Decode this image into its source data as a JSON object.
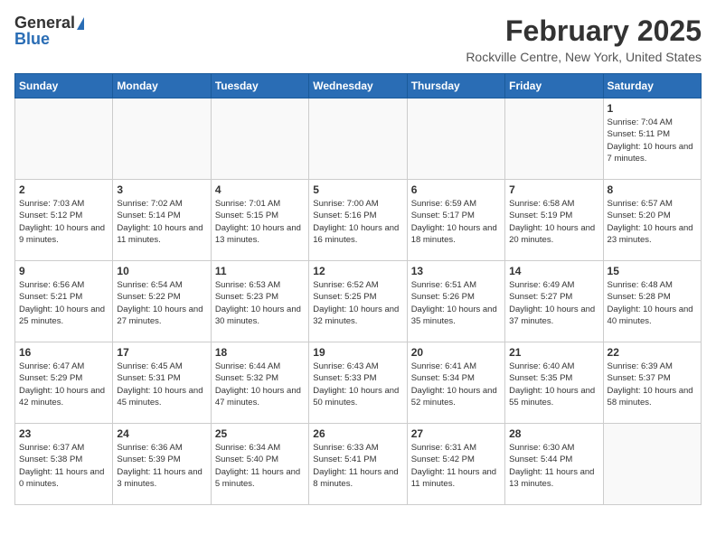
{
  "header": {
    "logo_general": "General",
    "logo_blue": "Blue",
    "month_year": "February 2025",
    "location": "Rockville Centre, New York, United States"
  },
  "weekdays": [
    "Sunday",
    "Monday",
    "Tuesday",
    "Wednesday",
    "Thursday",
    "Friday",
    "Saturday"
  ],
  "weeks": [
    [
      {
        "day": "",
        "info": ""
      },
      {
        "day": "",
        "info": ""
      },
      {
        "day": "",
        "info": ""
      },
      {
        "day": "",
        "info": ""
      },
      {
        "day": "",
        "info": ""
      },
      {
        "day": "",
        "info": ""
      },
      {
        "day": "1",
        "info": "Sunrise: 7:04 AM\nSunset: 5:11 PM\nDaylight: 10 hours and 7 minutes."
      }
    ],
    [
      {
        "day": "2",
        "info": "Sunrise: 7:03 AM\nSunset: 5:12 PM\nDaylight: 10 hours and 9 minutes."
      },
      {
        "day": "3",
        "info": "Sunrise: 7:02 AM\nSunset: 5:14 PM\nDaylight: 10 hours and 11 minutes."
      },
      {
        "day": "4",
        "info": "Sunrise: 7:01 AM\nSunset: 5:15 PM\nDaylight: 10 hours and 13 minutes."
      },
      {
        "day": "5",
        "info": "Sunrise: 7:00 AM\nSunset: 5:16 PM\nDaylight: 10 hours and 16 minutes."
      },
      {
        "day": "6",
        "info": "Sunrise: 6:59 AM\nSunset: 5:17 PM\nDaylight: 10 hours and 18 minutes."
      },
      {
        "day": "7",
        "info": "Sunrise: 6:58 AM\nSunset: 5:19 PM\nDaylight: 10 hours and 20 minutes."
      },
      {
        "day": "8",
        "info": "Sunrise: 6:57 AM\nSunset: 5:20 PM\nDaylight: 10 hours and 23 minutes."
      }
    ],
    [
      {
        "day": "9",
        "info": "Sunrise: 6:56 AM\nSunset: 5:21 PM\nDaylight: 10 hours and 25 minutes."
      },
      {
        "day": "10",
        "info": "Sunrise: 6:54 AM\nSunset: 5:22 PM\nDaylight: 10 hours and 27 minutes."
      },
      {
        "day": "11",
        "info": "Sunrise: 6:53 AM\nSunset: 5:23 PM\nDaylight: 10 hours and 30 minutes."
      },
      {
        "day": "12",
        "info": "Sunrise: 6:52 AM\nSunset: 5:25 PM\nDaylight: 10 hours and 32 minutes."
      },
      {
        "day": "13",
        "info": "Sunrise: 6:51 AM\nSunset: 5:26 PM\nDaylight: 10 hours and 35 minutes."
      },
      {
        "day": "14",
        "info": "Sunrise: 6:49 AM\nSunset: 5:27 PM\nDaylight: 10 hours and 37 minutes."
      },
      {
        "day": "15",
        "info": "Sunrise: 6:48 AM\nSunset: 5:28 PM\nDaylight: 10 hours and 40 minutes."
      }
    ],
    [
      {
        "day": "16",
        "info": "Sunrise: 6:47 AM\nSunset: 5:29 PM\nDaylight: 10 hours and 42 minutes."
      },
      {
        "day": "17",
        "info": "Sunrise: 6:45 AM\nSunset: 5:31 PM\nDaylight: 10 hours and 45 minutes."
      },
      {
        "day": "18",
        "info": "Sunrise: 6:44 AM\nSunset: 5:32 PM\nDaylight: 10 hours and 47 minutes."
      },
      {
        "day": "19",
        "info": "Sunrise: 6:43 AM\nSunset: 5:33 PM\nDaylight: 10 hours and 50 minutes."
      },
      {
        "day": "20",
        "info": "Sunrise: 6:41 AM\nSunset: 5:34 PM\nDaylight: 10 hours and 52 minutes."
      },
      {
        "day": "21",
        "info": "Sunrise: 6:40 AM\nSunset: 5:35 PM\nDaylight: 10 hours and 55 minutes."
      },
      {
        "day": "22",
        "info": "Sunrise: 6:39 AM\nSunset: 5:37 PM\nDaylight: 10 hours and 58 minutes."
      }
    ],
    [
      {
        "day": "23",
        "info": "Sunrise: 6:37 AM\nSunset: 5:38 PM\nDaylight: 11 hours and 0 minutes."
      },
      {
        "day": "24",
        "info": "Sunrise: 6:36 AM\nSunset: 5:39 PM\nDaylight: 11 hours and 3 minutes."
      },
      {
        "day": "25",
        "info": "Sunrise: 6:34 AM\nSunset: 5:40 PM\nDaylight: 11 hours and 5 minutes."
      },
      {
        "day": "26",
        "info": "Sunrise: 6:33 AM\nSunset: 5:41 PM\nDaylight: 11 hours and 8 minutes."
      },
      {
        "day": "27",
        "info": "Sunrise: 6:31 AM\nSunset: 5:42 PM\nDaylight: 11 hours and 11 minutes."
      },
      {
        "day": "28",
        "info": "Sunrise: 6:30 AM\nSunset: 5:44 PM\nDaylight: 11 hours and 13 minutes."
      },
      {
        "day": "",
        "info": ""
      }
    ]
  ]
}
